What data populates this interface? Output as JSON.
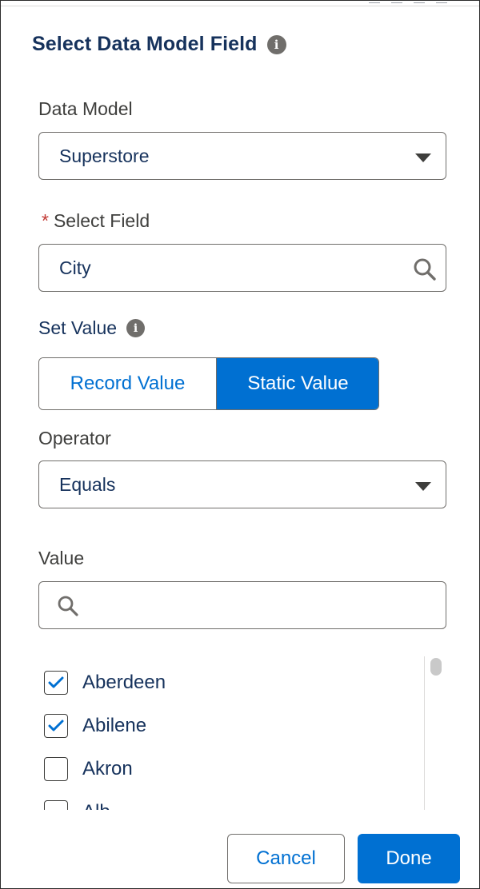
{
  "dialog": {
    "title": "Select Data Model Field"
  },
  "data_model": {
    "label": "Data Model",
    "value": "Superstore"
  },
  "select_field": {
    "required_mark": "*",
    "label": "Select Field",
    "value": "City"
  },
  "set_value": {
    "label": "Set Value",
    "options": [
      "Record Value",
      "Static Value"
    ],
    "selected": "Static Value"
  },
  "operator": {
    "label": "Operator",
    "value": "Equals"
  },
  "value": {
    "label": "Value",
    "search_value": "",
    "options": [
      {
        "label": "Aberdeen",
        "checked": true
      },
      {
        "label": "Abilene",
        "checked": true
      },
      {
        "label": "Akron",
        "checked": false
      },
      {
        "label": "Alb",
        "checked": false
      }
    ]
  },
  "footer": {
    "cancel_label": "Cancel",
    "done_label": "Done"
  },
  "colors": {
    "brand": "#0070d2",
    "title_text": "#16325c",
    "required": "#c23934"
  },
  "icons": {
    "title_info": "info-icon",
    "set_value_info": "info-icon",
    "field_search": "search-icon",
    "value_search": "search-icon",
    "dropdown": "chevron-down-icon",
    "check": "checkmark-icon"
  }
}
